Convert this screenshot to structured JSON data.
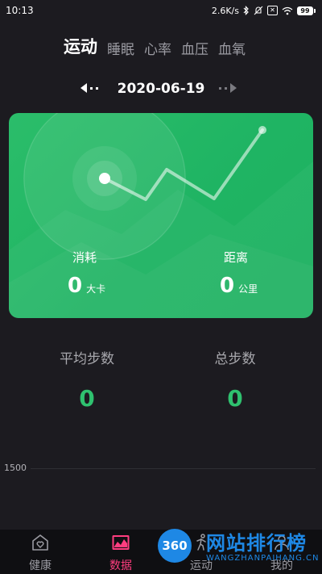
{
  "status_bar": {
    "time": "10:13",
    "network_speed": "2.6K/s",
    "icons": [
      "bluetooth-icon",
      "mute-icon",
      "notification-x-icon",
      "wifi-icon"
    ],
    "battery": "99"
  },
  "tabs": [
    {
      "label": "运动",
      "active": true
    },
    {
      "label": "睡眠",
      "active": false
    },
    {
      "label": "心率",
      "active": false
    },
    {
      "label": "血压",
      "active": false
    },
    {
      "label": "血氧",
      "active": false
    }
  ],
  "date": "2020-06-19",
  "summary_card": {
    "color": "#22b866",
    "consumption": {
      "label": "消耗",
      "value": "0",
      "unit": "大卡"
    },
    "distance": {
      "label": "距离",
      "value": "0",
      "unit": "公里"
    }
  },
  "stats": {
    "avg_steps": {
      "label": "平均步数",
      "value": "0"
    },
    "total_steps": {
      "label": "总步数",
      "value": "0"
    }
  },
  "chart": {
    "y_tick": "1500"
  },
  "bottom_nav": [
    {
      "label": "健康",
      "icon": "heart-house-icon",
      "active": false
    },
    {
      "label": "数据",
      "icon": "data-chart-icon",
      "active": true
    },
    {
      "label": "运动",
      "icon": "run-icon",
      "active": false
    },
    {
      "label": "我的",
      "icon": "profile-icon",
      "active": false
    }
  ],
  "watermark": {
    "badge": "360",
    "title": "网站排行榜",
    "subtitle": "WANGZHANPAIHANG.CN"
  },
  "colors": {
    "accent": "#2fc16f",
    "active_nav": "#ff3d7f",
    "background": "#1c1b20"
  }
}
